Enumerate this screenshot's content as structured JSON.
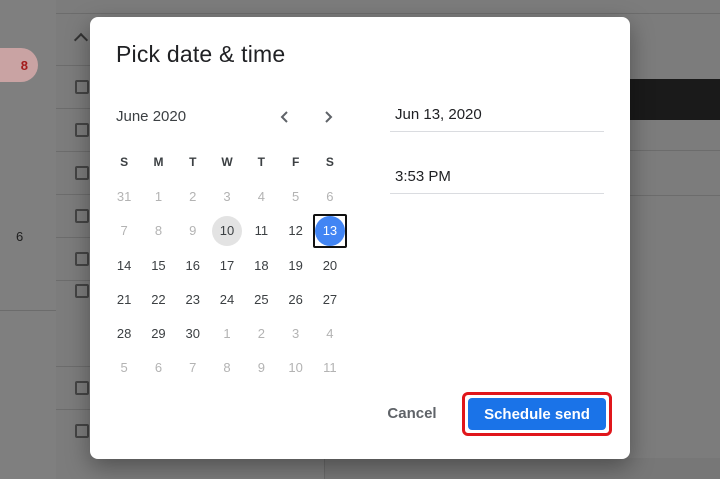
{
  "background": {
    "badge_count": "8",
    "side_number": "6"
  },
  "dialog": {
    "title": "Pick date & time",
    "calendar": {
      "month_label": "June 2020",
      "weekdays": [
        "S",
        "M",
        "T",
        "W",
        "T",
        "F",
        "S"
      ],
      "weeks": [
        [
          {
            "d": "31",
            "muted": true
          },
          {
            "d": "1",
            "muted": true
          },
          {
            "d": "2",
            "muted": true
          },
          {
            "d": "3",
            "muted": true
          },
          {
            "d": "4",
            "muted": true
          },
          {
            "d": "5",
            "muted": true
          },
          {
            "d": "6",
            "muted": true
          }
        ],
        [
          {
            "d": "7",
            "muted": true
          },
          {
            "d": "8",
            "muted": true
          },
          {
            "d": "9",
            "muted": true
          },
          {
            "d": "10",
            "today": true
          },
          {
            "d": "11"
          },
          {
            "d": "12"
          },
          {
            "d": "13",
            "selected": true
          }
        ],
        [
          {
            "d": "14"
          },
          {
            "d": "15"
          },
          {
            "d": "16"
          },
          {
            "d": "17"
          },
          {
            "d": "18"
          },
          {
            "d": "19"
          },
          {
            "d": "20"
          }
        ],
        [
          {
            "d": "21"
          },
          {
            "d": "22"
          },
          {
            "d": "23"
          },
          {
            "d": "24"
          },
          {
            "d": "25"
          },
          {
            "d": "26"
          },
          {
            "d": "27"
          }
        ],
        [
          {
            "d": "28"
          },
          {
            "d": "29"
          },
          {
            "d": "30"
          },
          {
            "d": "1",
            "muted": true
          },
          {
            "d": "2",
            "muted": true
          },
          {
            "d": "3",
            "muted": true
          },
          {
            "d": "4",
            "muted": true
          }
        ],
        [
          {
            "d": "5",
            "muted": true
          },
          {
            "d": "6",
            "muted": true
          },
          {
            "d": "7",
            "muted": true
          },
          {
            "d": "8",
            "muted": true
          },
          {
            "d": "9",
            "muted": true
          },
          {
            "d": "10",
            "muted": true
          },
          {
            "d": "11",
            "muted": true
          }
        ]
      ]
    },
    "date_value": "Jun 13, 2020",
    "time_value": "3:53 PM",
    "cancel_label": "Cancel",
    "schedule_label": "Schedule send"
  },
  "colors": {
    "accent": "#1a73e8",
    "selected_day": "#4285f4",
    "highlight_border": "#e0161b"
  },
  "icons": {
    "prev": "chevron-left-icon",
    "next": "chevron-right-icon"
  }
}
